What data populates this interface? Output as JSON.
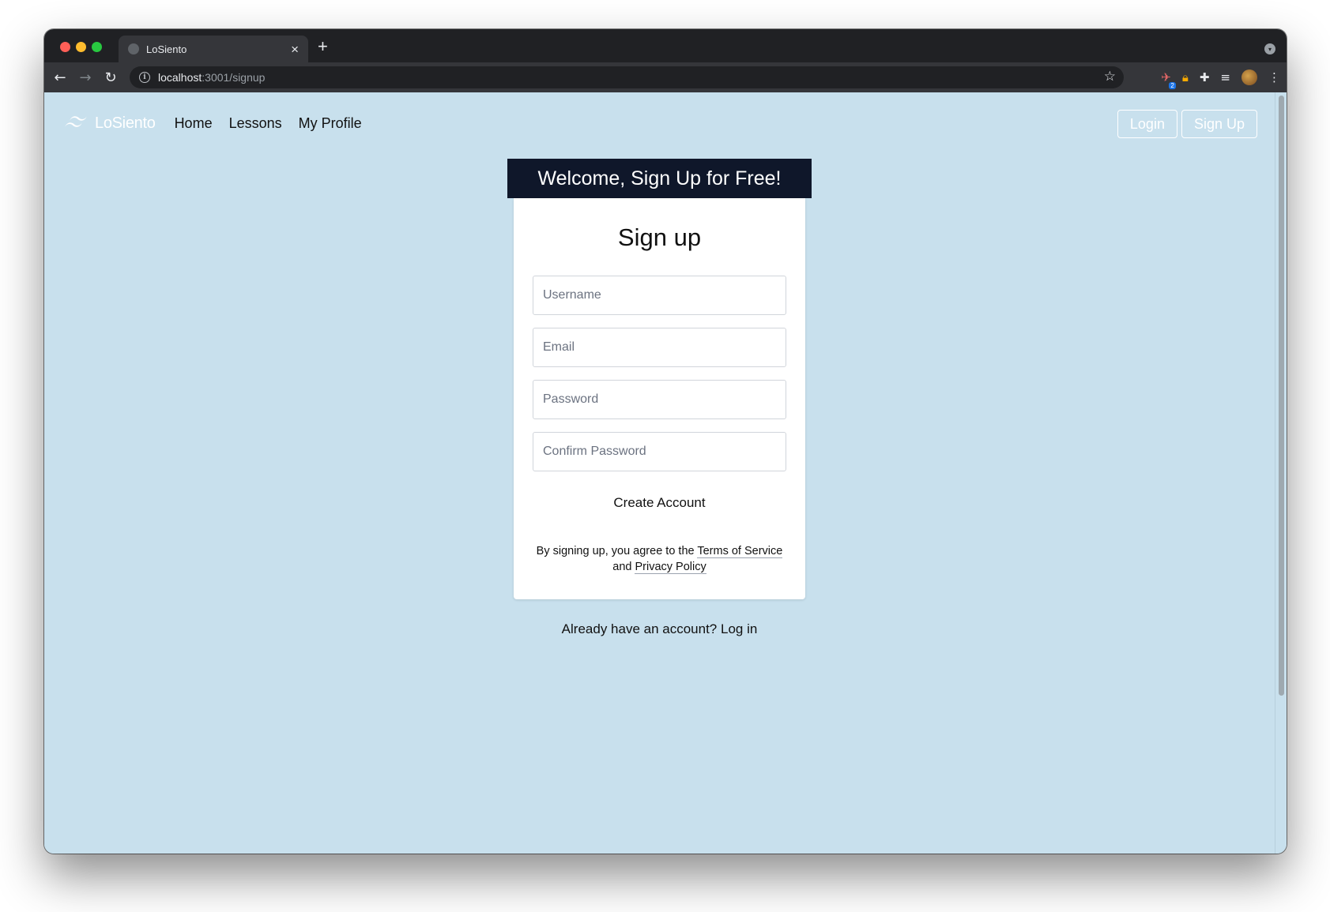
{
  "browser": {
    "tab_title": "LoSiento",
    "tab_close": "×",
    "new_tab": "+",
    "url_host": "localhost",
    "url_rest": ":3001/signup",
    "extension_badge": "2"
  },
  "nav": {
    "brand": "LoSiento",
    "links": [
      "Home",
      "Lessons",
      "My Profile"
    ],
    "login_label": "Login",
    "signup_label": "Sign Up"
  },
  "signup": {
    "banner": "Welcome, Sign Up for Free!",
    "title": "Sign up",
    "username_placeholder": "Username",
    "email_placeholder": "Email",
    "password_placeholder": "Password",
    "confirm_placeholder": "Confirm Password",
    "submit_label": "Create Account",
    "terms_prefix": "By signing up, you agree to the",
    "terms_link": "Terms of Service",
    "terms_and": "and",
    "privacy_link": "Privacy Policy",
    "already_text": "Already have an account?",
    "login_link": "Log in"
  },
  "colors": {
    "page_bg": "#c8e0ed",
    "banner_bg": "#0f172a",
    "card_bg": "#ffffff"
  },
  "icons": [
    "back-icon",
    "forward-icon",
    "reload-icon",
    "info-icon",
    "star-icon",
    "extension-icon",
    "lock-icon",
    "puzzle-icon",
    "media-icon",
    "avatar",
    "menu-icon",
    "tailwind-logo-icon"
  ]
}
